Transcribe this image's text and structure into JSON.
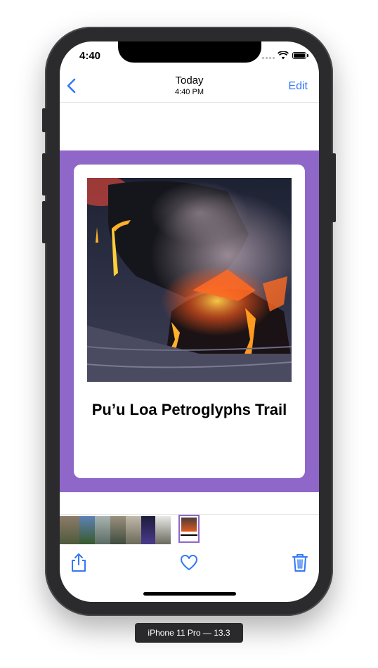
{
  "status_bar": {
    "time": "4:40"
  },
  "nav": {
    "title": "Today",
    "subtitle": "4:40 PM",
    "edit_label": "Edit"
  },
  "photo": {
    "caption": "Pu’u Loa Petroglyphs Trail",
    "background_color": "#8e67c9"
  },
  "toolbar": {
    "icons": [
      "share-icon",
      "heart-icon",
      "trash-icon"
    ],
    "accent_color": "#3478f6"
  },
  "device_label": "iPhone 11 Pro — 13.3"
}
